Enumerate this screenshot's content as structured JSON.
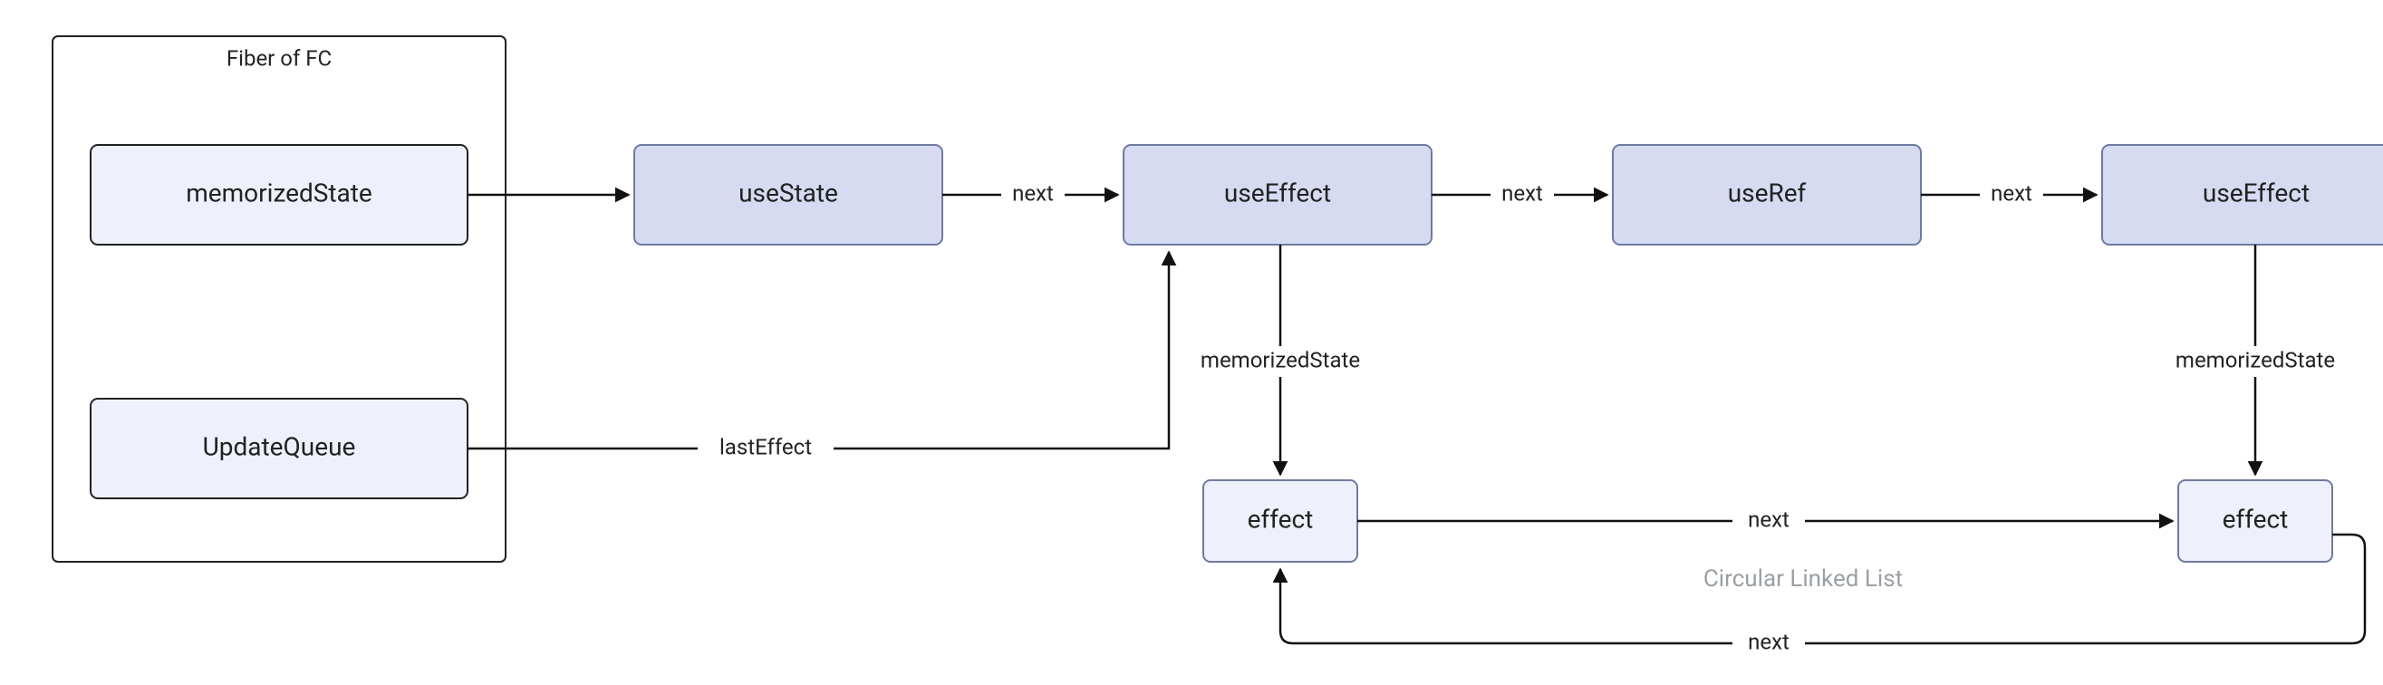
{
  "diagram": {
    "fiber": {
      "title": "Fiber of FC",
      "memorizedState": "memorizedState",
      "updateQueue": "UpdateQueue"
    },
    "hooks": {
      "useState": "useState",
      "useEffect1": "useEffect",
      "useRef": "useRef",
      "useEffect2": "useEffect"
    },
    "effects": {
      "effect1": "effect",
      "effect2": "effect"
    },
    "edges": {
      "next1": "next",
      "next2": "next",
      "next3": "next",
      "lastEffect": "lastEffect",
      "memorizedState1": "memorizedState",
      "memorizedState2": "memorizedState",
      "nextEffect1": "next",
      "nextEffect2": "next"
    },
    "note": "Circular Linked List"
  }
}
